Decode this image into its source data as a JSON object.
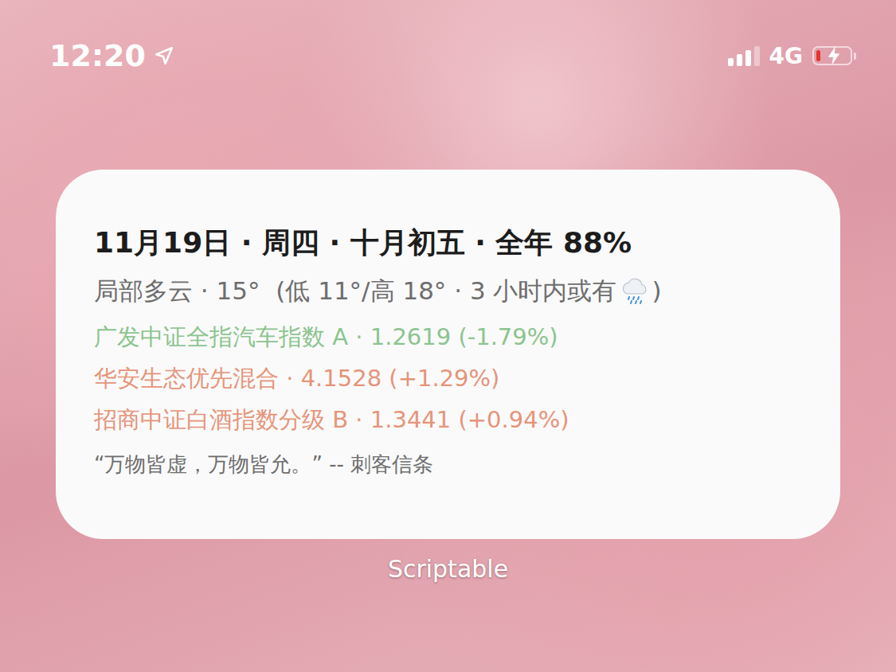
{
  "status_bar": {
    "time": "12:20",
    "location_active": true,
    "signal_bars": 3,
    "signal_max": 4,
    "network": "4G",
    "battery": {
      "level": 0.12,
      "charging": true,
      "low": true
    }
  },
  "widget": {
    "title": "11月19日 · 周四 · 十月初五 · 全年 88%",
    "weather": {
      "text": "局部多云 · 15°  (低 11°/高 18° · 3 小时内或有",
      "close": ")"
    },
    "funds": [
      {
        "text": "广发中证全指汽车指数 A · 1.2619 (-1.79%)",
        "color": "#8cc48f"
      },
      {
        "text": "华安生态优先混合 · 4.1528 (+1.29%)",
        "color": "#e5957a"
      },
      {
        "text": "招商中证白酒指数分级 B · 1.3441 (+0.94%)",
        "color": "#e5957a"
      }
    ],
    "quote": "“万物皆虚，万物皆允。” -- 刺客信条"
  },
  "app_label": "Scriptable"
}
